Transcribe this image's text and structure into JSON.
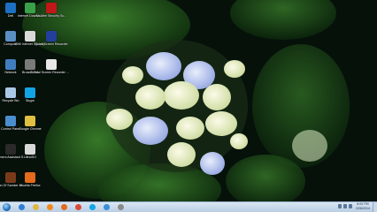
{
  "desktop": {
    "icons": [
      {
        "label": "Dell",
        "icon": "dell-icon",
        "color": "#1d6fc2"
      },
      {
        "label": "Internet Downlo...",
        "icon": "internet-download-manager-icon",
        "color": "#3aa14a"
      },
      {
        "label": "McAfee Security Sc...",
        "icon": "mcafee-icon",
        "color": "#c01818"
      },
      {
        "label": "Computer",
        "icon": "computer-icon",
        "color": "#5a8fc4"
      },
      {
        "label": "IDM Internet Security",
        "icon": "internet-security-icon",
        "color": "#d9d9d9"
      },
      {
        "label": "Quick Screen Recorder",
        "icon": "screen-recorder-icon",
        "color": "#233f9c"
      },
      {
        "label": "Network",
        "icon": "network-icon",
        "color": "#3f7fbf"
      },
      {
        "label": "BroadBand",
        "icon": "broadband-icon",
        "color": "#7a7a7a"
      },
      {
        "label": "Total Screen Recorder ...",
        "icon": "total-screen-recorder-icon",
        "color": "#e8e8e8"
      },
      {
        "label": "Recycle Bin",
        "icon": "recycle-bin-icon",
        "color": "#a9c9e6"
      },
      {
        "label": "Skype",
        "icon": "skype-icon",
        "color": "#12a5e6"
      },
      {
        "label": "Control Panel",
        "icon": "control-panel-icon",
        "color": "#4a8ed0"
      },
      {
        "label": "Google Chrome",
        "icon": "chrome-icon",
        "color": "#e0c040"
      },
      {
        "label": "Camera Assistant S...",
        "icon": "camera-icon",
        "color": "#2a2a2a"
      },
      {
        "label": "UltraISO",
        "icon": "ultraiso-icon",
        "color": "#d8d8d8"
      },
      {
        "label": "Son Of Samker Bl...",
        "icon": "game-icon",
        "color": "#7a3a1a"
      },
      {
        "label": "Mozilla Firefox",
        "icon": "firefox-icon",
        "color": "#e46a1d"
      }
    ]
  },
  "taskbar": {
    "apps": [
      {
        "name": "internet-explorer",
        "color": "#2f7fd6"
      },
      {
        "name": "windows-explorer",
        "color": "#e2b640"
      },
      {
        "name": "media-player",
        "color": "#f08a1c"
      },
      {
        "name": "firefox",
        "color": "#e46a1d"
      },
      {
        "name": "chrome",
        "color": "#d94a3a"
      },
      {
        "name": "skype",
        "color": "#12a5e6"
      },
      {
        "name": "app-7",
        "color": "#3a8fd8"
      },
      {
        "name": "app-8",
        "color": "#8a8a8a"
      }
    ],
    "time": "8:00 PM",
    "date": "2/26/2014"
  }
}
